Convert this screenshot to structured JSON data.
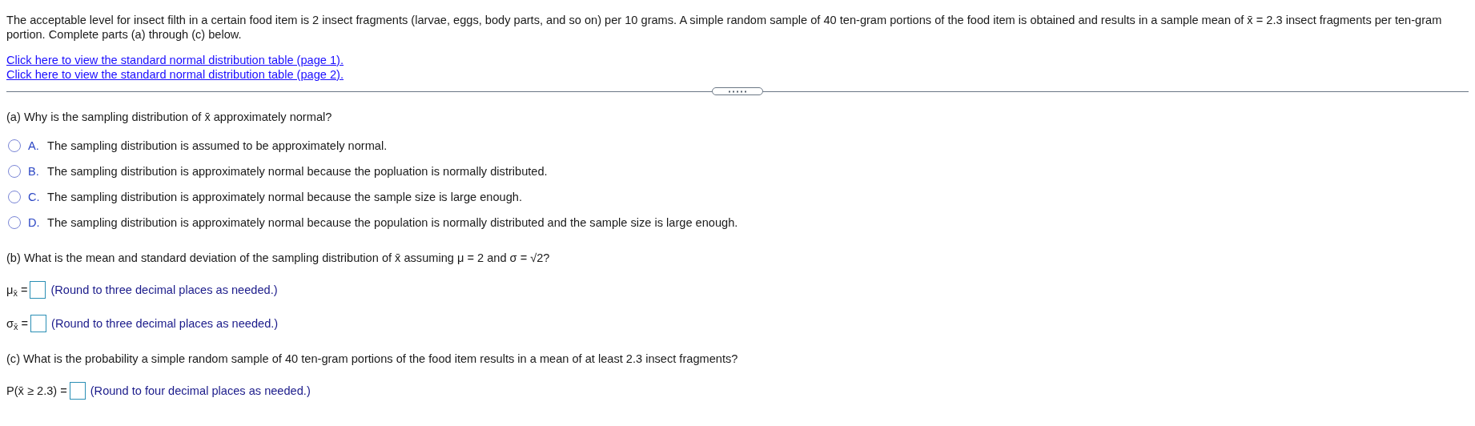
{
  "intro": "The acceptable level for insect filth in a certain food item is 2 insect fragments (larvae, eggs, body parts, and so on) per 10 grams. A simple random sample of 40 ten-gram portions of the food item is obtained and results in a sample mean of x̄ = 2.3 insect fragments per ten-gram portion. Complete parts (a) through (c) below.",
  "links": [
    "Click here to view the standard normal distribution table (page 1).",
    "Click here to view the standard normal distribution table (page 2)."
  ],
  "part_a": {
    "question": "(a) Why is the sampling distribution of x̄ approximately normal?",
    "options": [
      {
        "letter": "A.",
        "text": "The sampling distribution is assumed to be approximately normal.",
        "selected": false
      },
      {
        "letter": "B.",
        "text": "The sampling distribution is approximately normal because the popluation is normally distributed.",
        "selected": false
      },
      {
        "letter": "C.",
        "text": "The sampling distribution is approximately normal because the sample size is large enough.",
        "selected": false
      },
      {
        "letter": "D.",
        "text": "The sampling distribution is approximately normal because the population is normally distributed and the sample size is large enough.",
        "selected": false
      }
    ]
  },
  "part_b": {
    "question": "(b) What is the mean and standard deviation of the sampling distribution of x̄ assuming μ = 2 and σ = √2?",
    "answers": [
      {
        "label": "μ$_{x̄}$ =",
        "hint": "(Round to three decimal places as needed.)"
      },
      {
        "label": "σ$_{x̄}$ =",
        "hint": "(Round to three decimal places as needed.)"
      }
    ]
  },
  "part_c": {
    "question": "(c) What is the probability a simple random sample of 40 ten-gram portions of the food item results in a mean of at least 2.3 insect fragments?",
    "answers": [
      {
        "label": "P(x̄ ≥ 2.3) =",
        "hint": "(Round to four decimal places as needed.)"
      }
    ]
  }
}
